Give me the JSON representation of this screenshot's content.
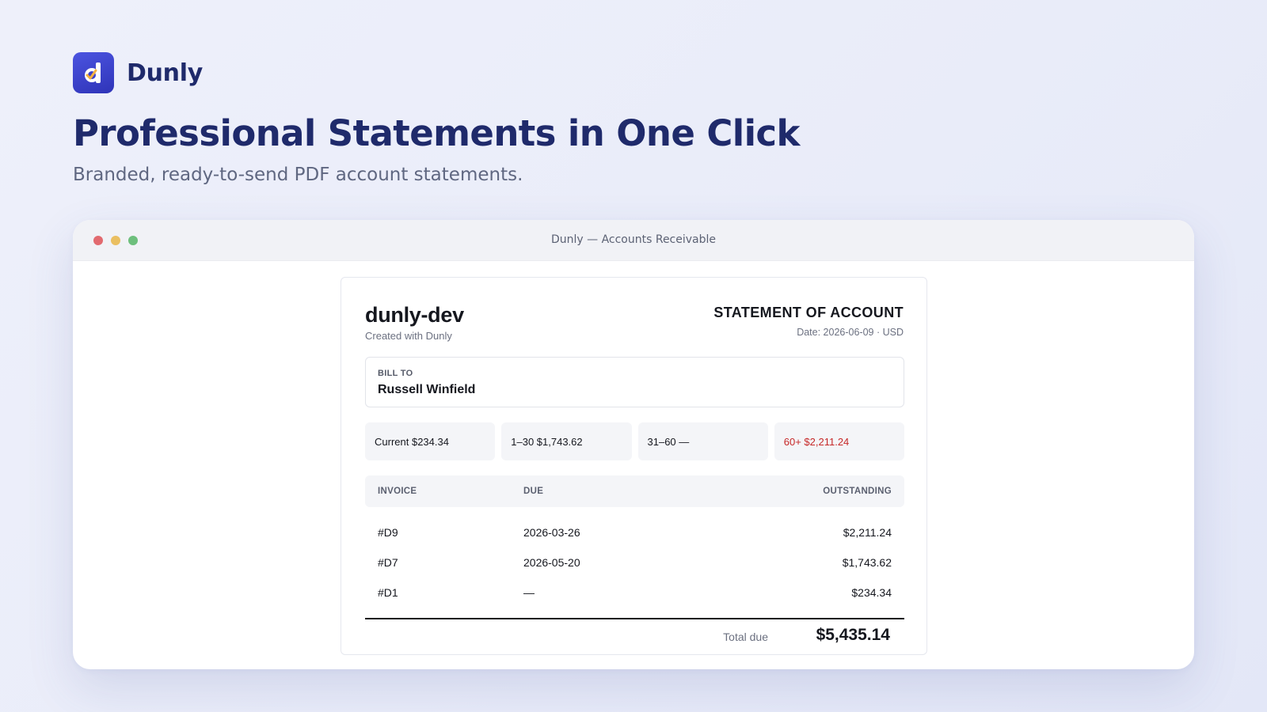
{
  "brand": {
    "name": "Dunly",
    "logo_glyph": "d",
    "accent": "#3b42cc"
  },
  "hero": {
    "headline": "Professional Statements in One Click",
    "subhead": "Branded, ready-to-send PDF account statements."
  },
  "window": {
    "title": "Dunly — Accounts Receivable"
  },
  "statement": {
    "company": "dunly-dev",
    "created_with": "Created with Dunly",
    "doc_title": "STATEMENT OF ACCOUNT",
    "date_line": "Date: 2026-06-09 · USD",
    "bill_to": {
      "label": "BILL TO",
      "name": "Russell Winfield"
    },
    "aging": [
      {
        "label": "Current $234.34"
      },
      {
        "label": "1–30 $1,743.62"
      },
      {
        "label": "31–60 —"
      },
      {
        "label": "60+ $2,211.24"
      }
    ],
    "columns": {
      "invoice": "INVOICE",
      "due": "DUE",
      "outstanding": "OUTSTANDING"
    },
    "rows": [
      {
        "invoice": "#D9",
        "due": "2026-03-26",
        "outstanding": "$2,211.24"
      },
      {
        "invoice": "#D7",
        "due": "2026-05-20",
        "outstanding": "$1,743.62"
      },
      {
        "invoice": "#D1",
        "due": "—",
        "outstanding": "$234.34"
      }
    ],
    "total": {
      "label": "Total due",
      "value": "$5,435.14"
    },
    "overdue_color": "#c62828"
  }
}
